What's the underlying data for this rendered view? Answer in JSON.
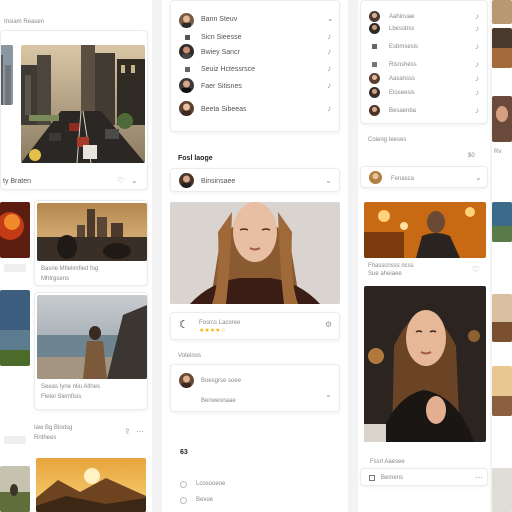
{
  "left_column": {
    "header": "Insiam Reasen",
    "feed_label": "ty Braten",
    "caption1": "Basrie Mtlelimfied fog",
    "caption1b": "Mhtrgsens",
    "caption2": "Seeas Iyne nliu Alfnes",
    "caption2b": "Fletel Slemfisis",
    "caption3": "Iaw Bg Bindsg",
    "caption3b": "Rnthees",
    "icon_names": [
      "heart-icon",
      "share-icon",
      "more-icon"
    ]
  },
  "middle_column": {
    "list": [
      {
        "name": "Bann Steuv"
      },
      {
        "name": "Sicn Sieesse"
      },
      {
        "name": "Bwiey Sancr"
      },
      {
        "name": "Seuiz Hctessrsce"
      },
      {
        "name": "Faer Sitisnes"
      },
      {
        "name": "Beeta Sibeeas"
      }
    ],
    "section_title": "Fosl laoge",
    "profile_name": "Binsinsaee",
    "review_name": "Fosrcs Lacoree",
    "rating": 4,
    "section2": "Voteinos",
    "comment_name": "Boesgrse soee",
    "comment_sub": "Benwesnaae",
    "count": "63",
    "footer_items": [
      "Lcosooeoe",
      "Bevoe"
    ]
  },
  "right_column": {
    "list": [
      {
        "name": "Aahinuae"
      },
      {
        "name": "Lbessbss"
      },
      {
        "name": "Esbmsesis"
      },
      {
        "name": "Risnshess"
      },
      {
        "name": "Aasansss"
      },
      {
        "name": "Eloseesis"
      },
      {
        "name": "Besaenba"
      }
    ],
    "section_title": "Coieng Ieeses",
    "count": "$0",
    "profile_name": "Fenasca",
    "caption": "Fhasscnsss ncss",
    "caption_b": "Sue aheiaee",
    "footer_title": "Fssrl Aaesee",
    "footer_item": "Bemens"
  },
  "colors": {
    "background": "#f3f3f3",
    "card": "#ffffff",
    "accent_star": "#f4b400"
  }
}
